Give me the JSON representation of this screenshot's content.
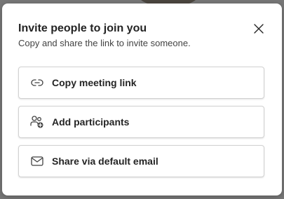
{
  "dialog": {
    "title": "Invite people to join you",
    "subtitle": "Copy and share the link to invite someone.",
    "close_icon": "close-icon"
  },
  "options": [
    {
      "label": "Copy meeting link",
      "icon": "link-icon"
    },
    {
      "label": "Add participants",
      "icon": "add-people-icon"
    },
    {
      "label": "Share via default email",
      "icon": "mail-icon"
    }
  ],
  "colors": {
    "text": "#242424",
    "border": "#d1d1d1",
    "background": "#ffffff"
  }
}
